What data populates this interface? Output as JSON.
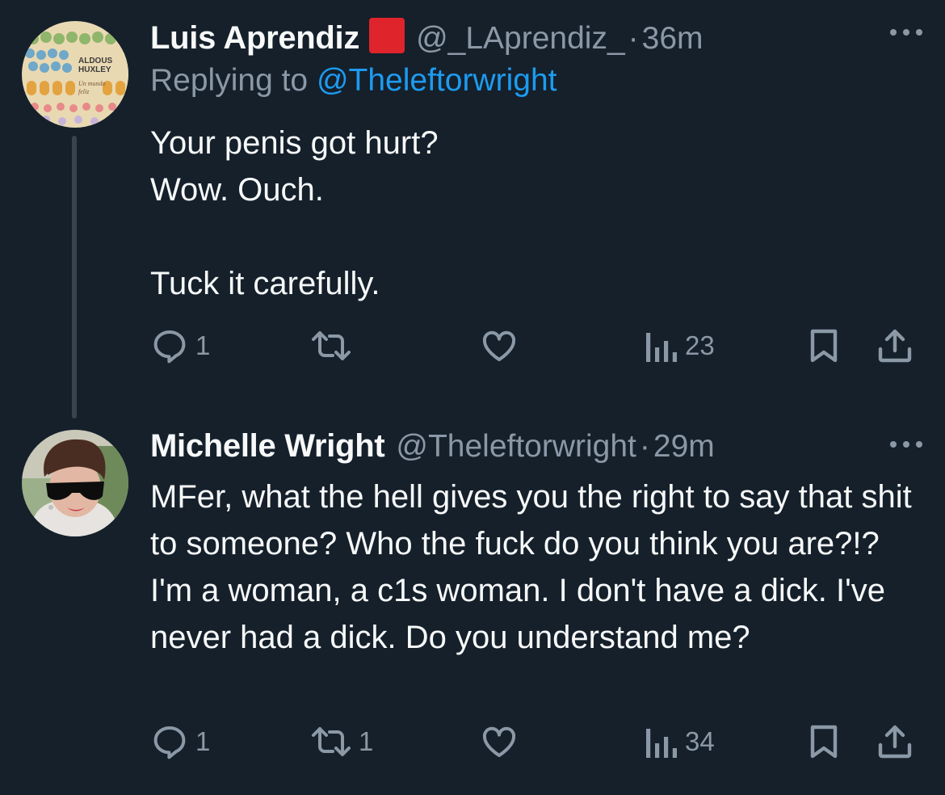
{
  "tweets": [
    {
      "author_name": "Luis Aprendiz",
      "author_handle": "@_LAprendiz_",
      "separator": "·",
      "time": "36m",
      "replying_prefix": "Replying to ",
      "replying_to": "@Theleftorwright",
      "text": "Your penis got hurt?\nWow. Ouch.\n\nTuck it carefully.",
      "avatar_book": {
        "author_line1": "ALDOUS",
        "author_line2": "HUXLEY",
        "title_line1": "Un mundo",
        "title_line2": "feliz"
      },
      "stats": {
        "replies": "1",
        "retweets": "",
        "likes": "",
        "views": "23"
      }
    },
    {
      "author_name": "Michelle Wright",
      "author_handle": "@Theleftorwright",
      "separator": "·",
      "time": "29m",
      "text": "MFer, what the hell gives you the right to say that shit to someone? Who the fuck do you think you are?!? I'm a woman, a c1s woman. I don't have a dick. I've never had a dick. Do you understand me?",
      "stats": {
        "replies": "1",
        "retweets": "1",
        "likes": "",
        "views": "34"
      }
    }
  ],
  "icons": {
    "flag": "red-square-emoji",
    "more": "ellipsis-icon",
    "reply": "speech-bubble-icon",
    "retweet": "retweet-arrows-icon",
    "like": "heart-outline-icon",
    "views": "bar-chart-icon",
    "bookmark": "bookmark-icon",
    "share": "share-upload-icon"
  },
  "colors": {
    "background": "#15202b",
    "text_primary": "#f7f9f9",
    "text_secondary": "#8b98a5",
    "link": "#1d9bf0",
    "thread_line": "#38444d",
    "flag_red": "#e0242b"
  }
}
